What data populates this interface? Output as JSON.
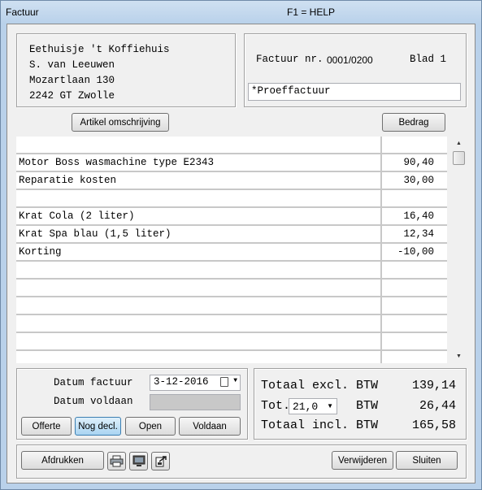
{
  "window": {
    "title": "Factuur",
    "help": "F1 = HELP"
  },
  "address": {
    "lines": [
      "Eethuisje 't Koffiehuis",
      "S. van Leeuwen",
      "Mozartlaan 130",
      "2242 GT  Zwolle"
    ]
  },
  "invoice": {
    "number_label": "Factuur nr.",
    "number": "0001/0200",
    "page_label": "Blad 1",
    "note": "*Proeffactuur"
  },
  "columns": {
    "description": "Artikel omschrijving",
    "amount": "Bedrag"
  },
  "lines": [
    {
      "description": "",
      "amount": ""
    },
    {
      "description": "Motor Boss wasmachine type E2343",
      "amount": "90,40"
    },
    {
      "description": "Reparatie kosten",
      "amount": "30,00"
    },
    {
      "description": "",
      "amount": ""
    },
    {
      "description": "Krat Cola (2 liter)",
      "amount": "16,40"
    },
    {
      "description": "Krat Spa blau (1,5 liter)",
      "amount": "12,34"
    },
    {
      "description": "Korting",
      "amount": "-10,00"
    },
    {
      "description": "",
      "amount": ""
    },
    {
      "description": "",
      "amount": ""
    },
    {
      "description": "",
      "amount": ""
    },
    {
      "description": "",
      "amount": ""
    },
    {
      "description": "",
      "amount": ""
    },
    {
      "description": "",
      "amount": ""
    }
  ],
  "dates": {
    "invoice_date_label": "Datum factuur",
    "invoice_date": "3-12-2016",
    "paid_date_label": "Datum voldaan",
    "paid_date": ""
  },
  "status_buttons": {
    "offerte": "Offerte",
    "nog_decl": "Nog decl.",
    "open": "Open",
    "voldaan": "Voldaan"
  },
  "totals": {
    "excl_label": "Totaal excl. BTW",
    "excl_value": "139,14",
    "tot_label": "Tot.",
    "vat_rate": "21,0",
    "btw_label": "BTW",
    "vat_value": "26,44",
    "incl_label": "Totaal incl. BTW",
    "incl_value": "165,58"
  },
  "footer": {
    "print": "Afdrukken",
    "delete": "Verwijderen",
    "close": "Sluiten"
  },
  "icons": {
    "print": "printer-icon",
    "preview": "monitor-icon",
    "export": "export-icon",
    "calendar": "calendar-icon",
    "dropdown": "chevron-down-icon"
  }
}
